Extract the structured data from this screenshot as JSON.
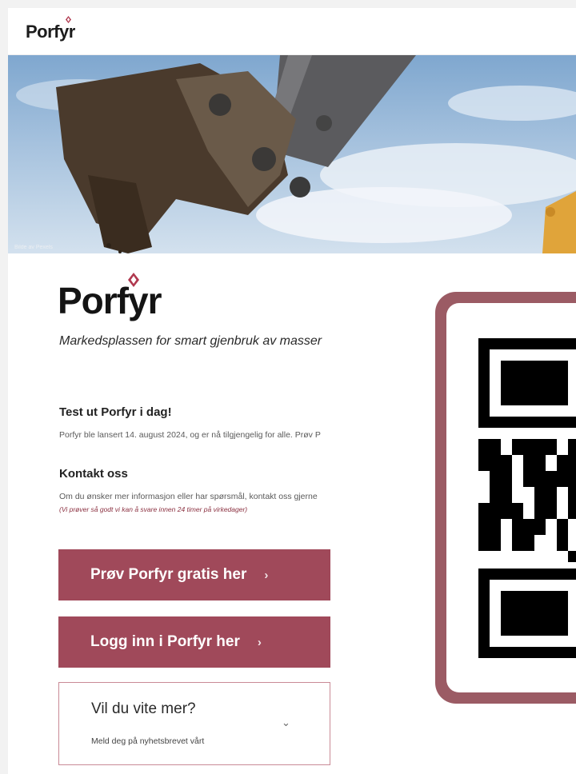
{
  "header": {
    "brand": "Porfyr"
  },
  "hero": {
    "credit": "Bilde av Pexels"
  },
  "logo": {
    "text": "Porfyr",
    "tagline": "Markedsplassen for smart gjenbruk av masser"
  },
  "sections": {
    "test": {
      "heading": "Test ut Porfyr i dag!",
      "body": "Porfyr ble lansert 14. august 2024, og er nå tilgjengelig for alle. Prøv P"
    },
    "contact": {
      "heading": "Kontakt oss",
      "body": "Om du ønsker mer informasjon eller har spørsmål, kontakt oss gjerne",
      "note": "(Vi prøver så godt vi kan å svare innen 24 timer på virkedager)"
    }
  },
  "buttons": {
    "try": "Prøv Porfyr gratis her",
    "login": "Logg inn i Porfyr her",
    "chevron": "›"
  },
  "newsletter": {
    "title": "Vil du vite mer?",
    "subtitle": "Meld deg på nyhetsbrevet vårt",
    "chevron": "⌄"
  },
  "colors": {
    "accent": "#a0495a",
    "card": "#9b5b64",
    "brand_gem": "#b0384e"
  },
  "icons": [
    "diamond-logo-icon",
    "chevron-right-icon",
    "chevron-down-icon",
    "qr-code"
  ]
}
